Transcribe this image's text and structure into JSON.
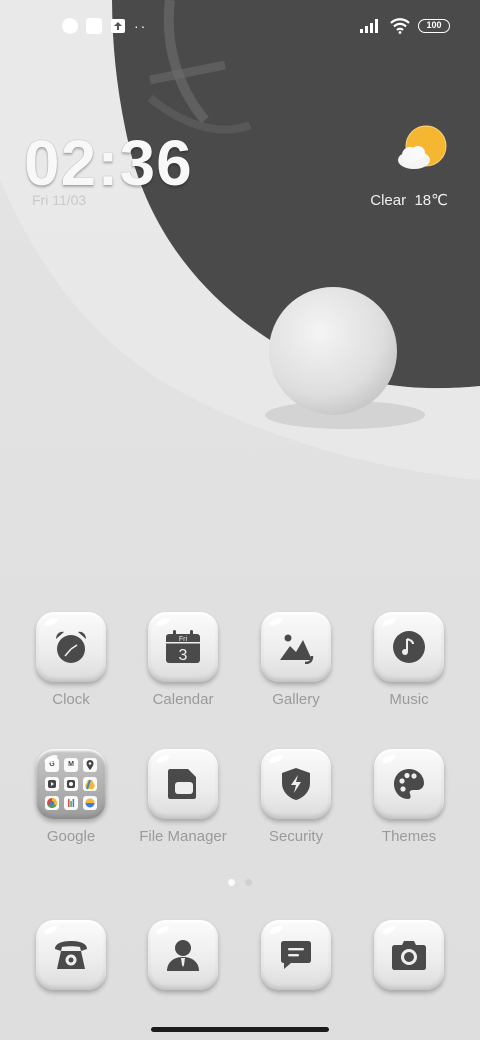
{
  "status_bar": {
    "overflow": "··",
    "battery": "100",
    "icons": [
      "notification-app-icon",
      "notification-square-icon",
      "upload-icon",
      "signal-icon",
      "wifi-icon",
      "battery-icon"
    ]
  },
  "clock_widget": {
    "time": "02:36",
    "date": "Fri 11/03"
  },
  "weather_widget": {
    "condition": "Clear",
    "temperature": "18℃",
    "icon": "sun-behind-cloud-icon"
  },
  "apps": [
    {
      "label": "Clock",
      "icon": "alarm-clock-icon"
    },
    {
      "label": "Calendar",
      "icon": "calendar-icon",
      "day": "Fri",
      "date": "3"
    },
    {
      "label": "Gallery",
      "icon": "mountain-photo-icon"
    },
    {
      "label": "Music",
      "icon": "music-note-icon"
    },
    {
      "label": "Google",
      "icon": "folder-icon",
      "folder_apps": [
        "G",
        "M",
        "",
        "",
        "",
        "",
        "",
        "",
        ""
      ]
    },
    {
      "label": "File Manager",
      "icon": "folder-file-icon"
    },
    {
      "label": "Security",
      "icon": "shield-bolt-icon"
    },
    {
      "label": "Themes",
      "icon": "palette-icon"
    }
  ],
  "dock": [
    {
      "name": "Phone",
      "icon": "phone-icon"
    },
    {
      "name": "Contacts",
      "icon": "contact-person-icon"
    },
    {
      "name": "Messages",
      "icon": "message-bubble-icon"
    },
    {
      "name": "Camera",
      "icon": "camera-icon"
    }
  ],
  "page_indicator": {
    "pages": 2,
    "current": 1
  },
  "colors": {
    "accent_dark": "#4d4d4d",
    "background": "#e6e6e6",
    "icon_glyph": "#4a4a4a"
  }
}
